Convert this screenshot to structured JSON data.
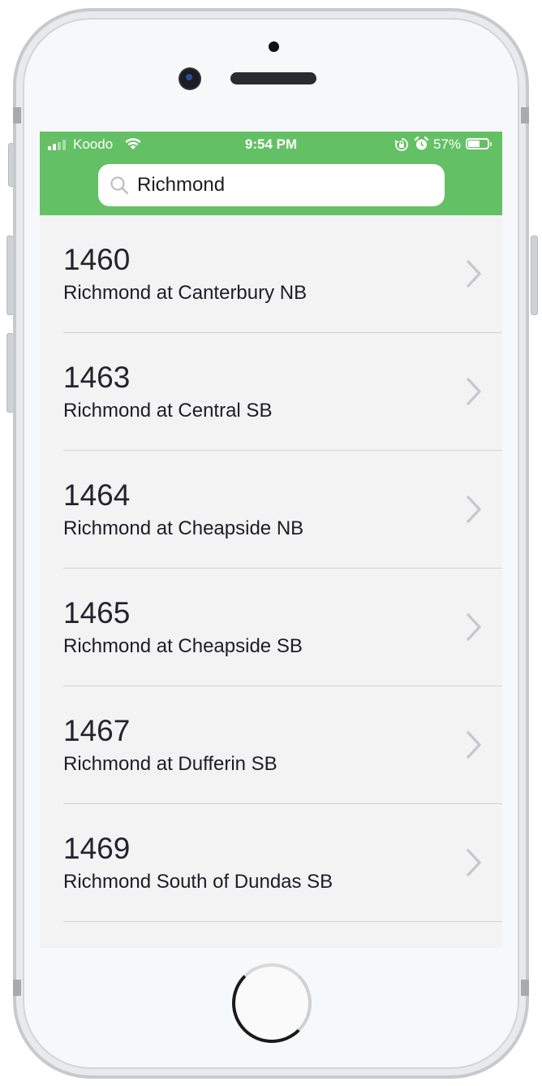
{
  "status_bar": {
    "carrier": "Koodo",
    "time": "9:54 PM",
    "battery_percent": "57%",
    "battery_level": 0.57,
    "signal_bars_filled": 2,
    "signal_bars_total": 4,
    "icons": [
      "signal-icon",
      "wifi-icon",
      "orientation-lock-icon",
      "alarm-icon",
      "battery-icon"
    ]
  },
  "search": {
    "value": "Richmond",
    "icon": "search-icon"
  },
  "stops": [
    {
      "number": "1460",
      "name": "Richmond at Canterbury NB"
    },
    {
      "number": "1463",
      "name": "Richmond at Central SB"
    },
    {
      "number": "1464",
      "name": "Richmond at Cheapside NB"
    },
    {
      "number": "1465",
      "name": "Richmond at Cheapside SB"
    },
    {
      "number": "1467",
      "name": "Richmond at Dufferin SB"
    },
    {
      "number": "1469",
      "name": "Richmond South of Dundas SB"
    }
  ],
  "colors": {
    "header_green": "#64c065",
    "list_background": "#f3f3f3",
    "text_primary": "#1d1d24",
    "chevron": "#c7c7cc",
    "separator": "#d2d2d2"
  }
}
